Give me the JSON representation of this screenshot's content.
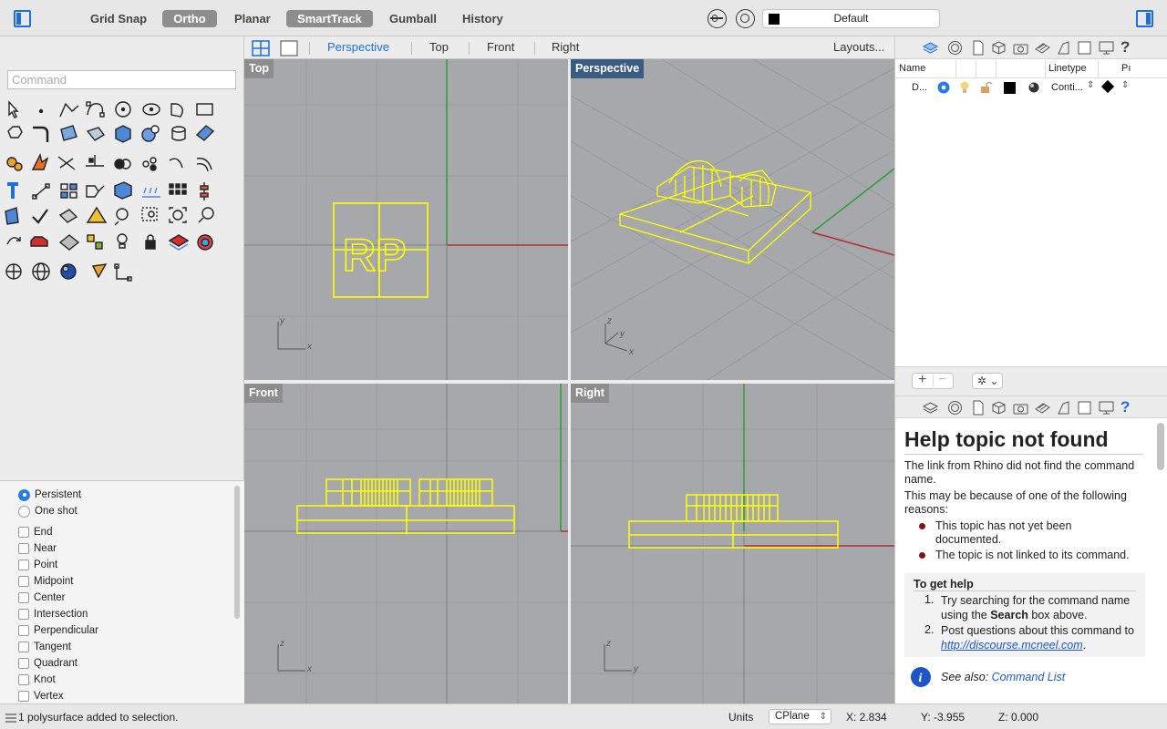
{
  "toolbar": {
    "grid_snap": "Grid Snap",
    "ortho": "Ortho",
    "planar": "Planar",
    "smarttrack": "SmartTrack",
    "gumball": "Gumball",
    "history": "History",
    "active_layer": "Default",
    "accent": "#1e6fd9"
  },
  "command": {
    "placeholder": "Command"
  },
  "viewport_tabs": {
    "perspective": "Perspective",
    "top": "Top",
    "front": "Front",
    "right": "Right",
    "layouts": "Layouts..."
  },
  "viewports": {
    "top": "Top",
    "perspective": "Perspective",
    "front": "Front",
    "right": "Right"
  },
  "model_text": "RP",
  "osnap": {
    "persistent": "Persistent",
    "one_shot": "One shot",
    "items": [
      "End",
      "Near",
      "Point",
      "Midpoint",
      "Center",
      "Intersection",
      "Perpendicular",
      "Tangent",
      "Quadrant",
      "Knot",
      "Vertex"
    ]
  },
  "layers": {
    "col_name": "Name",
    "col_linetype": "Linetype",
    "col_print": "Pı",
    "row_name": "D...",
    "row_linetype": "Conti..."
  },
  "help": {
    "title": "Help topic not found",
    "p1": "The link from Rhino did not find the command name.",
    "p2": "This may be because of one of the following reasons:",
    "r1": "This topic has not yet been documented.",
    "r2": "The topic is not linked to its command.",
    "get_help_title": "To get help",
    "step1_pre": "Try searching for the command name using the ",
    "step1_bold": "Search",
    "step1_post": " box above.",
    "step2_pre": "Post questions about this command to ",
    "step2_link": "http://discourse.mcneel.com",
    "step2_post": ".",
    "see_also": "See also:",
    "see_also_link": "Command List"
  },
  "status": {
    "message": "1 polysurface added to selection.",
    "units": "Units",
    "cplane": "CPlane",
    "x": "X: 2.834",
    "y": "Y: -3.955",
    "z": "Z: 0.000"
  }
}
